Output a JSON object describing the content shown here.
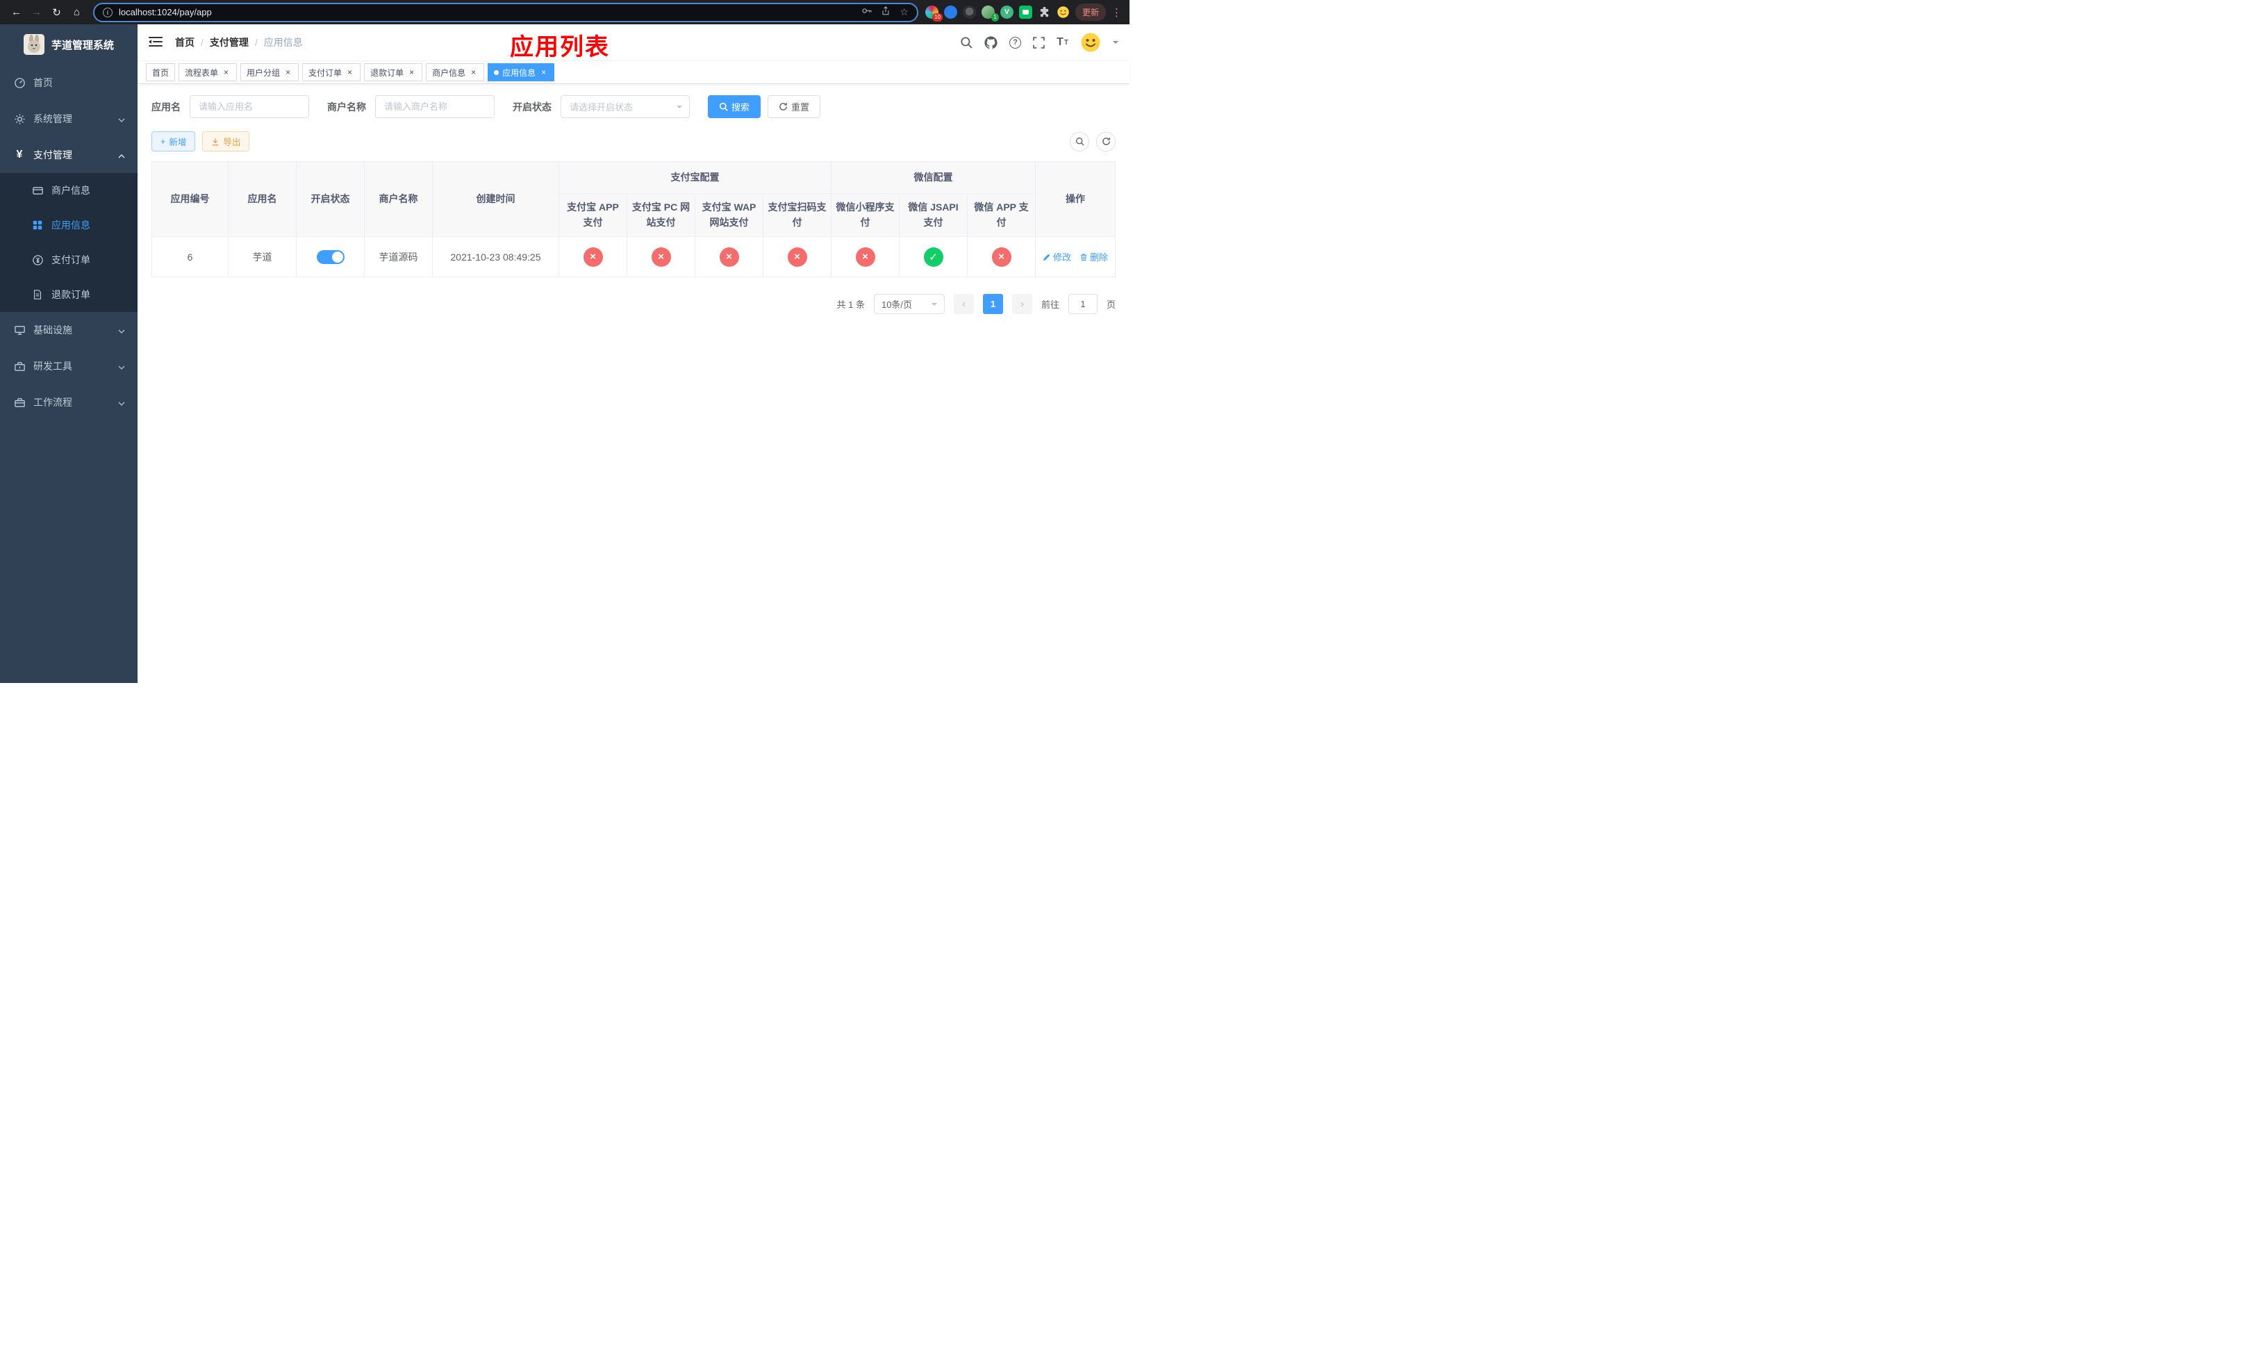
{
  "colors": {
    "primary": "#409eff",
    "danger": "#f56c6c",
    "success": "#13ce66",
    "warning": "#e6a23c",
    "annotation_red": "#ff0000",
    "sidebar_bg": "#304156",
    "submenu_bg": "#1f2d3d",
    "chrome_bg": "#202124"
  },
  "browser": {
    "url": "localhost:1024/pay/app",
    "update_label": "更新",
    "extension_badge_count": "10",
    "profile_badge_count": "1"
  },
  "sidebar": {
    "app_title": "芋道管理系统",
    "items": [
      {
        "label": "首页"
      },
      {
        "label": "系统管理"
      },
      {
        "label": "支付管理"
      },
      {
        "label": "基础设施"
      },
      {
        "label": "研发工具"
      },
      {
        "label": "工作流程"
      }
    ],
    "submenu": [
      {
        "label": "商户信息"
      },
      {
        "label": "应用信息"
      },
      {
        "label": "支付订单"
      },
      {
        "label": "退款订单"
      }
    ]
  },
  "header": {
    "breadcrumb": [
      "首页",
      "支付管理",
      "应用信息"
    ],
    "breadcrumb_sep": "/",
    "overlay_title": "应用列表"
  },
  "tabs": [
    {
      "label": "首页",
      "closable": false,
      "active": false
    },
    {
      "label": "流程表单",
      "closable": true,
      "active": false
    },
    {
      "label": "用户分组",
      "closable": true,
      "active": false
    },
    {
      "label": "支付订单",
      "closable": true,
      "active": false
    },
    {
      "label": "退款订单",
      "closable": true,
      "active": false
    },
    {
      "label": "商户信息",
      "closable": true,
      "active": false
    },
    {
      "label": "应用信息",
      "closable": true,
      "active": true
    }
  ],
  "filters": {
    "app_name_label": "应用名",
    "app_name_placeholder": "请输入应用名",
    "merchant_label": "商户名称",
    "merchant_placeholder": "请输入商户名称",
    "status_label": "开启状态",
    "status_placeholder": "请选择开启状态",
    "search_button": "搜索",
    "reset_button": "重置"
  },
  "toolbar": {
    "add_button": "新增",
    "export_button": "导出"
  },
  "table": {
    "headers": {
      "app_id": "应用编号",
      "app_name": "应用名",
      "status": "开启状态",
      "merchant_name": "商户名称",
      "create_time": "创建时间",
      "alipay_group": "支付宝配置",
      "wechat_group": "微信配置",
      "alipay_app": "支付宝 APP 支付",
      "alipay_pc": "支付宝 PC 网站支付",
      "alipay_wap": "支付宝 WAP 网站支付",
      "alipay_qr": "支付宝扫码支付",
      "wx_lite": "微信小程序支付",
      "wx_jsapi": "微信 JSAPI 支付",
      "wx_app": "微信 APP 支付",
      "actions": "操作"
    },
    "row": {
      "app_id": "6",
      "app_name": "芋道",
      "status_on": true,
      "merchant_name": "芋道源码",
      "create_time": "2021-10-23 08:49:25",
      "alipay_app_enabled": false,
      "alipay_pc_enabled": false,
      "alipay_wap_enabled": false,
      "alipay_qr_enabled": false,
      "wx_lite_enabled": false,
      "wx_jsapi_enabled": true,
      "wx_app_enabled": false,
      "edit_label": "修改",
      "delete_label": "删除"
    }
  },
  "pagination": {
    "total_text": "共 1 条",
    "page_size": "10条/页",
    "current_page": "1",
    "goto_prefix": "前往",
    "goto_value": "1",
    "goto_suffix": "页"
  },
  "glyphs": {
    "fail": "×",
    "success": "✓",
    "close": "×",
    "prev": "‹",
    "next": "›",
    "back": "←",
    "forward": "→",
    "reload": "↻",
    "home": "⌂",
    "star": "☆",
    "more": "⋮",
    "plus": "+",
    "yen": "¥",
    "info": "i",
    "font_t_big": "T",
    "font_t_small": "T"
  }
}
